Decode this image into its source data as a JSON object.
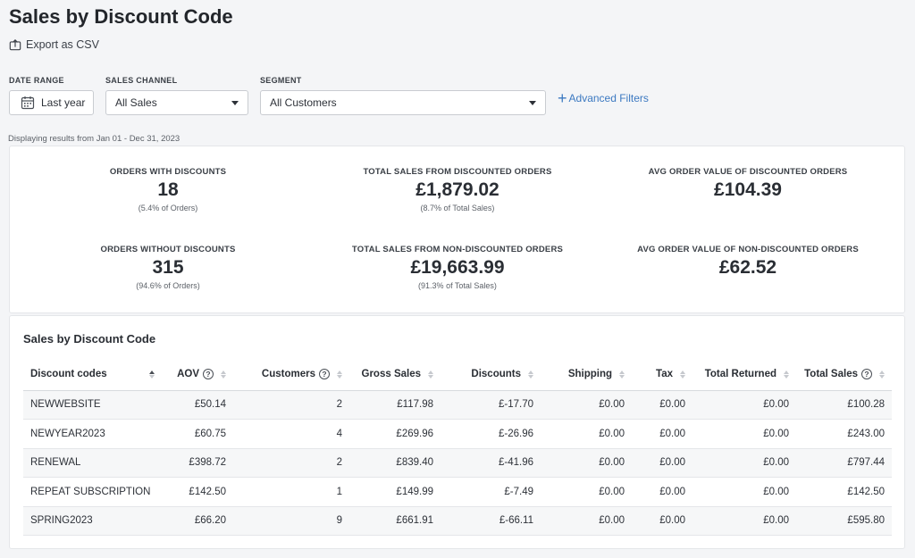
{
  "page": {
    "title": "Sales by Discount Code",
    "export_label": "Export as CSV"
  },
  "filters": {
    "date_range": {
      "label": "DATE RANGE",
      "value": "Last year"
    },
    "sales_channel": {
      "label": "SALES CHANNEL",
      "value": "All Sales"
    },
    "segment": {
      "label": "SEGMENT",
      "value": "All Customers"
    },
    "advanced_label": "Advanced Filters"
  },
  "display_range": "Displaying results from Jan 01 - Dec 31, 2023",
  "stats": [
    {
      "label": "ORDERS WITH DISCOUNTS",
      "value": "18",
      "sub": "(5.4% of Orders)"
    },
    {
      "label": "TOTAL SALES FROM DISCOUNTED ORDERS",
      "value": "£1,879.02",
      "sub": "(8.7% of Total Sales)"
    },
    {
      "label": "AVG ORDER VALUE OF DISCOUNTED ORDERS",
      "value": "£104.39",
      "sub": ""
    },
    {
      "label": "ORDERS WITHOUT DISCOUNTS",
      "value": "315",
      "sub": "(94.6% of Orders)"
    },
    {
      "label": "TOTAL SALES FROM NON-DISCOUNTED ORDERS",
      "value": "£19,663.99",
      "sub": "(91.3% of Total Sales)"
    },
    {
      "label": "AVG ORDER VALUE OF NON-DISCOUNTED ORDERS",
      "value": "£62.52",
      "sub": ""
    }
  ],
  "table": {
    "title": "Sales by Discount Code",
    "columns": [
      "Discount codes",
      "AOV",
      "Customers",
      "Gross Sales",
      "Discounts",
      "Shipping",
      "Tax",
      "Total Returned",
      "Total Sales"
    ],
    "rows": [
      [
        "NEWWEBSITE",
        "£50.14",
        "2",
        "£117.98",
        "£-17.70",
        "£0.00",
        "£0.00",
        "£0.00",
        "£100.28"
      ],
      [
        "NEWYEAR2023",
        "£60.75",
        "4",
        "£269.96",
        "£-26.96",
        "£0.00",
        "£0.00",
        "£0.00",
        "£243.00"
      ],
      [
        "RENEWAL",
        "£398.72",
        "2",
        "£839.40",
        "£-41.96",
        "£0.00",
        "£0.00",
        "£0.00",
        "£797.44"
      ],
      [
        "REPEAT SUBSCRIPTION",
        "£142.50",
        "1",
        "£149.99",
        "£-7.49",
        "£0.00",
        "£0.00",
        "£0.00",
        "£142.50"
      ],
      [
        "SPRING2023",
        "£66.20",
        "9",
        "£661.91",
        "£-66.11",
        "£0.00",
        "£0.00",
        "£0.00",
        "£595.80"
      ]
    ]
  },
  "icons": {
    "export": "export-icon",
    "calendar": "calendar-icon",
    "help": "help-circle-icon",
    "sort": "sort-icon"
  },
  "colors": {
    "accent": "#3c79c1",
    "background": "#f4f5f7"
  }
}
